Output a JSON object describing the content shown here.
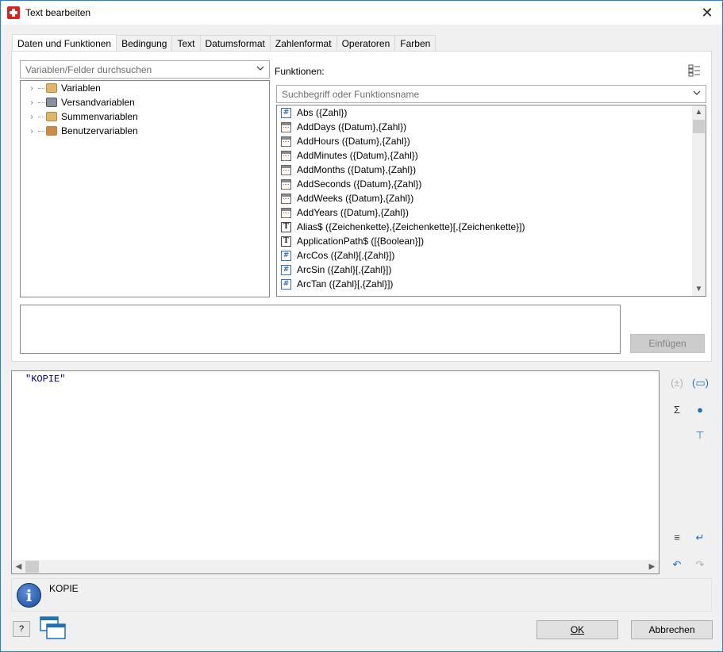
{
  "window": {
    "title": "Text bearbeiten"
  },
  "tabs": [
    {
      "label": "Daten und Funktionen",
      "active": true
    },
    {
      "label": "Bedingung",
      "active": false
    },
    {
      "label": "Text",
      "active": false
    },
    {
      "label": "Datumsformat",
      "active": false
    },
    {
      "label": "Zahlenformat",
      "active": false
    },
    {
      "label": "Operatoren",
      "active": false
    },
    {
      "label": "Farben",
      "active": false
    }
  ],
  "variables": {
    "search_placeholder": "Variablen/Felder durchsuchen",
    "tree": [
      {
        "label": "Variablen",
        "icon": "variables-icon"
      },
      {
        "label": "Versandvariablen",
        "icon": "shipping-variables-icon"
      },
      {
        "label": "Summenvariablen",
        "icon": "sum-variables-icon"
      },
      {
        "label": "Benutzervariablen",
        "icon": "user-variables-icon"
      }
    ]
  },
  "functions": {
    "label": "Funktionen:",
    "search_placeholder": "Suchbegriff oder Funktionsname",
    "items": [
      {
        "label": "Abs ({Zahl})",
        "icon": "number"
      },
      {
        "label": "AddDays ({Datum},{Zahl})",
        "icon": "date"
      },
      {
        "label": "AddHours ({Datum},{Zahl})",
        "icon": "date"
      },
      {
        "label": "AddMinutes ({Datum},{Zahl})",
        "icon": "date"
      },
      {
        "label": "AddMonths ({Datum},{Zahl})",
        "icon": "date"
      },
      {
        "label": "AddSeconds ({Datum},{Zahl})",
        "icon": "date"
      },
      {
        "label": "AddWeeks ({Datum},{Zahl})",
        "icon": "date"
      },
      {
        "label": "AddYears ({Datum},{Zahl})",
        "icon": "date"
      },
      {
        "label": "Alias$ ({Zeichenkette},{Zeichenkette}[,{Zeichenkette}])",
        "icon": "text"
      },
      {
        "label": "ApplicationPath$ ([{Boolean}])",
        "icon": "text"
      },
      {
        "label": "ArcCos ({Zahl}[,{Zahl}])",
        "icon": "number"
      },
      {
        "label": "ArcSin ({Zahl}[,{Zahl}])",
        "icon": "number"
      },
      {
        "label": "ArcTan ({Zahl}[,{Zahl}])",
        "icon": "number"
      }
    ]
  },
  "insert_button": "Einfügen",
  "editor": {
    "content": "\"KOPIE\""
  },
  "info": {
    "text": "KOPIE"
  },
  "buttons": {
    "ok": "OK",
    "cancel": "Abbrechen",
    "help": "?"
  }
}
